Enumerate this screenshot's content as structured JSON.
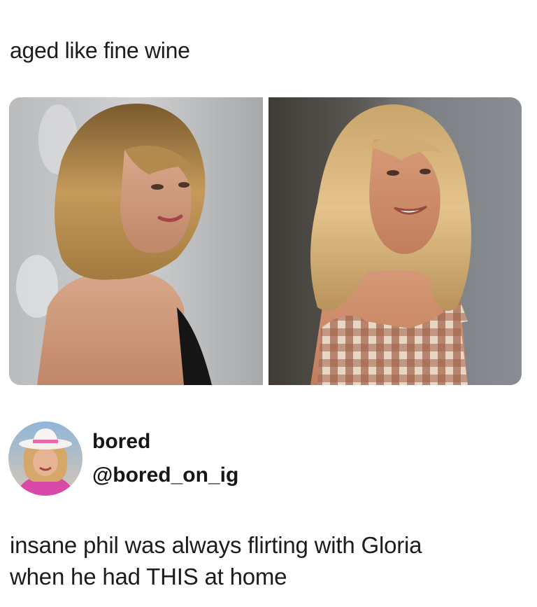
{
  "caption": "aged like fine wine",
  "photos": {
    "left_icon": "young-woman-photo",
    "right_icon": "older-woman-photo"
  },
  "profile": {
    "display_name": "bored",
    "handle": "@bored_on_ig",
    "avatar_icon": "cowgirl-avatar"
  },
  "post": {
    "line1": "insane phil was always flirting with Gloria",
    "line2": "when he had THIS at home"
  }
}
